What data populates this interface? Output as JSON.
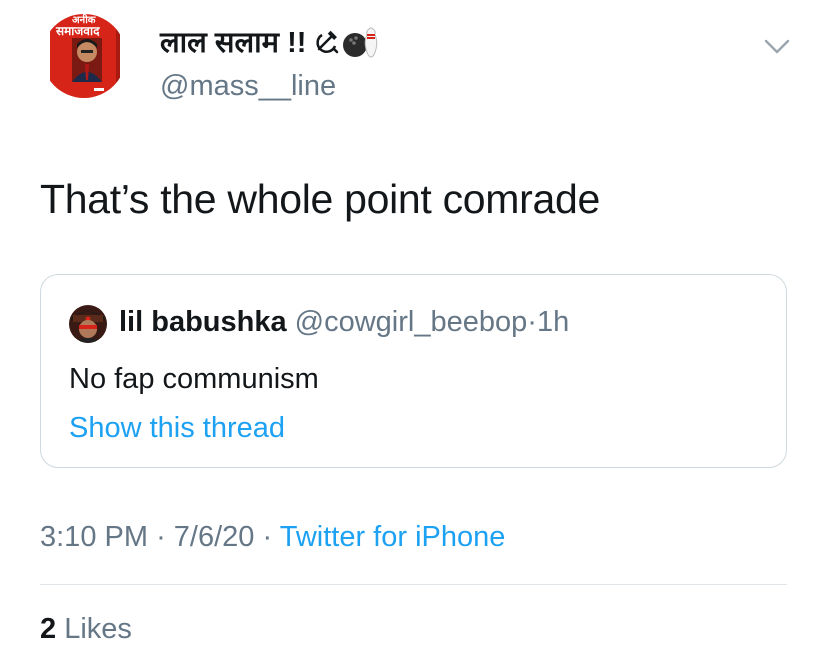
{
  "tweet": {
    "display_name": "लाल सलाम !!",
    "display_name_emoji": [
      "hammer-sickle-icon",
      "bowling-icon"
    ],
    "handle": "@mass__line",
    "text": "That’s the whole point comrade",
    "timestamp_time": "3:10 PM",
    "timestamp_date": "7/6/20",
    "source": "Twitter for iPhone",
    "likes_count": "2",
    "likes_label": "Likes"
  },
  "avatar": {
    "book_title": "समाजवाद",
    "book_top_text": "अनीक"
  },
  "quote": {
    "display_name": "lil babushka",
    "handle": "@cowgirl_beebop",
    "time": "1h",
    "text": "No fap communism",
    "link": "Show this thread"
  },
  "separators": {
    "dot": "·"
  },
  "colors": {
    "text": "#14171a",
    "secondary": "#657786",
    "link": "#1da1f2",
    "border": "#cfd9de"
  }
}
